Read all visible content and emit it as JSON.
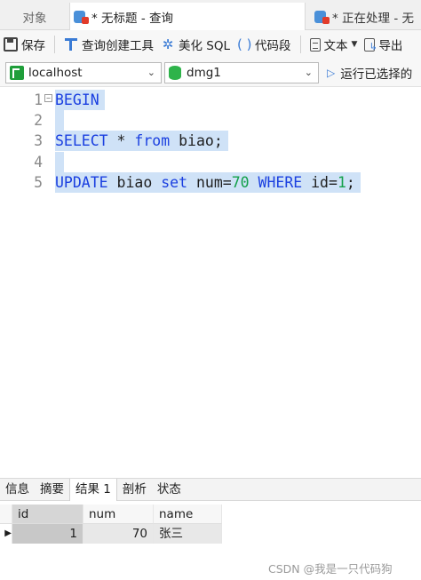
{
  "tabs": {
    "objects": "对象",
    "query": "* 无标题 - 查询",
    "running": "* 正在处理 - 无"
  },
  "toolbar": {
    "save": "保存",
    "query_builder": "查询创建工具",
    "beautify": "美化 SQL",
    "snippet": "代码段",
    "text": "文本",
    "export": "导出"
  },
  "connection": {
    "server": "localhost",
    "database": "dmg1",
    "run_selected": "运行已选择的"
  },
  "editor": {
    "lines": [
      {
        "num": "1",
        "parts": [
          {
            "t": "BEGIN",
            "c": "kw"
          }
        ]
      },
      {
        "num": "2",
        "parts": []
      },
      {
        "num": "3",
        "parts": [
          {
            "t": "SELECT",
            "c": "kw"
          },
          {
            "t": " * ",
            "c": ""
          },
          {
            "t": "from",
            "c": "kw"
          },
          {
            "t": " biao;",
            "c": ""
          }
        ]
      },
      {
        "num": "4",
        "parts": []
      },
      {
        "num": "5",
        "parts": [
          {
            "t": "UPDATE",
            "c": "kw"
          },
          {
            "t": " biao ",
            "c": ""
          },
          {
            "t": "set",
            "c": "kw"
          },
          {
            "t": " num=",
            "c": ""
          },
          {
            "t": "70",
            "c": "num"
          },
          {
            "t": " ",
            "c": ""
          },
          {
            "t": "WHERE",
            "c": "kw"
          },
          {
            "t": " id=",
            "c": ""
          },
          {
            "t": "1",
            "c": "num"
          },
          {
            "t": ";",
            "c": ""
          }
        ]
      }
    ]
  },
  "result_tabs": [
    "信息",
    "摘要",
    "结果 1",
    "剖析",
    "状态"
  ],
  "active_result_tab": 2,
  "grid": {
    "columns": [
      "id",
      "num",
      "name"
    ],
    "rows": [
      [
        "1",
        "70",
        "张三"
      ]
    ]
  },
  "watermark": "CSDN @我是一只代码狗"
}
